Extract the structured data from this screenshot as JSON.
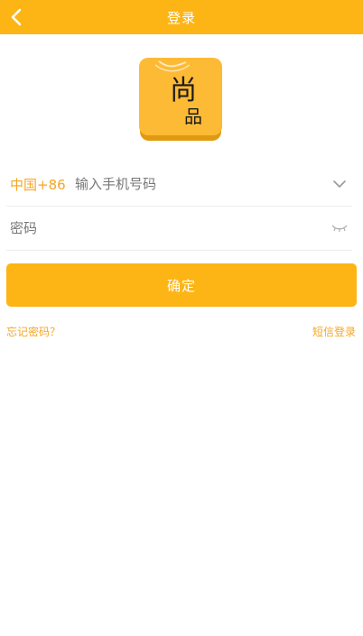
{
  "header": {
    "title": "登录",
    "back_icon": "chevron-left-icon"
  },
  "logo": {
    "char1": "尚",
    "char2": "品"
  },
  "form": {
    "country_code": "中国+86",
    "phone_placeholder": "输入手机号码",
    "password_placeholder": "密码",
    "dropdown_icon": "chevron-down-icon",
    "password_toggle_icon": "eye-closed-icon"
  },
  "actions": {
    "confirm_label": "确定",
    "forgot_password": "忘记密码？",
    "sms_login": "短信登录"
  },
  "colors": {
    "accent": "#FDB515",
    "link": "#F5A623"
  }
}
